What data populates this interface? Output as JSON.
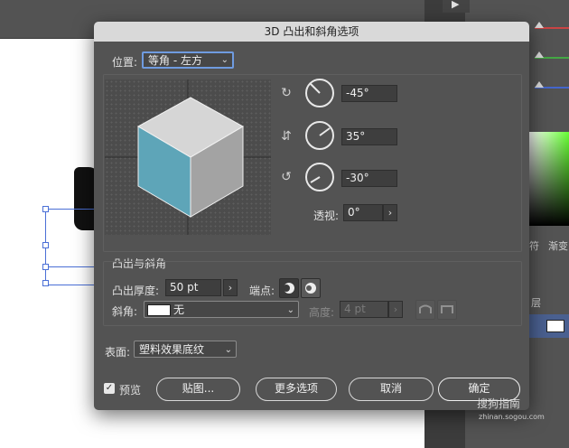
{
  "dialog": {
    "title": "3D 凸出和斜角选项",
    "position": {
      "label": "位置:",
      "value": "等角 - 左方"
    },
    "rotation": {
      "x": "-45°",
      "y": "35°",
      "z": "-30°"
    },
    "perspective": {
      "label": "透视:",
      "value": "0°"
    },
    "extrude_bevel": {
      "section_label": "凸出与斜角",
      "depth_label": "凸出厚度:",
      "depth_value": "50 pt",
      "cap_label": "端点:",
      "bevel_label": "斜角:",
      "bevel_value": "无",
      "height_label": "高度:",
      "height_value": "4 pt"
    },
    "surface": {
      "label": "表面:",
      "value": "塑料效果底纹"
    },
    "preview_label": "预览",
    "buttons": {
      "map_art": "贴图...",
      "more_options": "更多选项",
      "cancel": "取消",
      "ok": "确定"
    }
  },
  "cube_colors": {
    "top": "#d6d6d6",
    "left": "#5ea5b8",
    "right": "#a3a3a3"
  },
  "right_panel": {
    "tab_1": "渐变",
    "tab_2": "层",
    "tab_3": "符"
  },
  "watermark": {
    "text": "搜狗指南",
    "sub": "zhinan.sogou.com"
  }
}
